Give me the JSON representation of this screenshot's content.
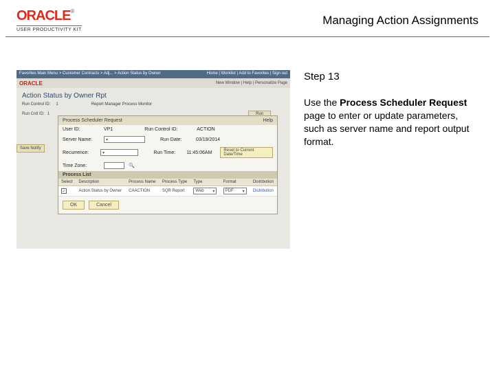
{
  "header": {
    "brand": "ORACLE",
    "brand_sub": "USER PRODUCTIVITY KIT",
    "doc_title": "Managing Action Assignments"
  },
  "instructions": {
    "step_label": "Step 13",
    "text_before": "Use the ",
    "bold": "Process Scheduler Request",
    "text_after": " page to enter or update parameters, such as server name and report output format."
  },
  "screenshot": {
    "nav_left": "Favorites   Main Menu > Customer Contracts > Adj... > Action Status by Owner",
    "nav_right": "Home | Worklist | Add to Favorites | Sign out",
    "brand": "ORACLE",
    "brand_right": "New Window | Help | Personalize Page",
    "page_title": "Action Status by Owner Rpt",
    "sub_run": "Run Control ID:",
    "sub_run_val": "1",
    "sub_links": "Report Manager   Process Monitor",
    "run_button": "Run",
    "runline_label": "Run Cntl ID:",
    "runline_val": "1",
    "side_strip": "Save   Notify",
    "modal": {
      "title": "Process Scheduler Request",
      "help": "Help",
      "user_lab": "User ID:",
      "user_val": "VP1",
      "runctrl_lab": "Run Control ID:",
      "runctrl_val": "ACTION",
      "server_lab": "Server Name:",
      "rundate_lab": "Run Date:",
      "rundate_val": "03/19/2014",
      "recur_lab": "Recurrence:",
      "runtime_lab": "Run Time:",
      "runtime_val": "11:45:06AM",
      "reset_btn": "Reset to Current Date/Time",
      "tz_lab": "Time Zone:",
      "tz_icon": "🔍",
      "list_title": "Process List",
      "col_select": "Select",
      "col_desc": "Description",
      "col_pname": "Process Name",
      "col_ptype": "Process Type",
      "col_type": "Type",
      "col_format": "Format",
      "col_dist": "Distribution",
      "row": {
        "checked": "✓",
        "desc": "Action Status by Owner",
        "pname": "CAACTION",
        "ptype": "SQR Report",
        "type": "Web",
        "format": "PDF",
        "dist": "Distribution"
      },
      "ok": "OK",
      "cancel": "Cancel"
    }
  }
}
